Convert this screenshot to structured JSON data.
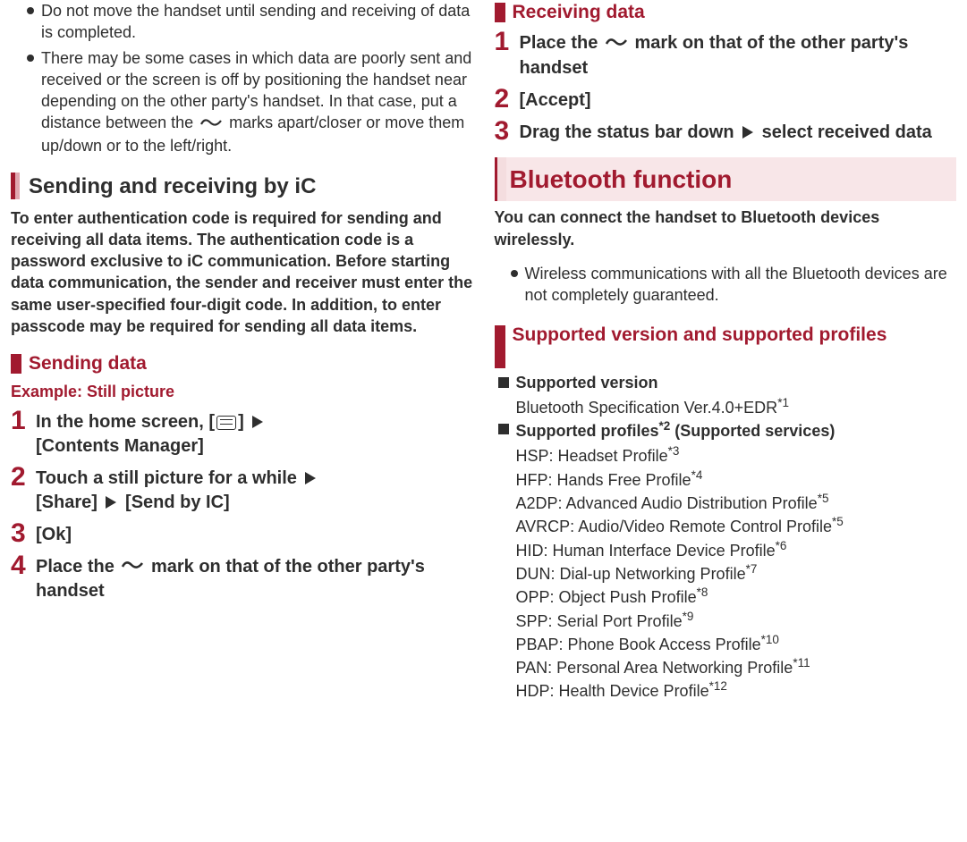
{
  "leftTop": {
    "bullets": [
      "Do not move the handset until sending and receiving of data is completed.",
      {
        "pre": "There may be some cases in which data are poorly sent and received or the screen is off by positioning the handset near depending on the other party's handset. In that case, put a distance between the ",
        "post": " marks apart/closer or move them up/down or to the left/right."
      }
    ]
  },
  "sendRecv": {
    "heading": "Sending and receiving by iC",
    "intro": "To enter authentication code is required for sending and receiving all data items. The authentication code is a password exclusive to iC communication. Before starting data communication, the sender and receiver must enter the same user-specified four-digit code. In addition, to enter passcode may be required for sending all data items."
  },
  "sending": {
    "heading": "Sending data",
    "example": "Example: Still picture",
    "steps": {
      "s1a": "In the home screen, [",
      "s1b": "]",
      "s1c": "[Contents Manager]",
      "s2a": "Touch a still picture for a while",
      "s2b": "[Share]",
      "s2c": "[Send by IC]",
      "s3": "[Ok]",
      "s4a": "Place the ",
      "s4b": " mark on that of the other party's handset"
    }
  },
  "receiving": {
    "heading": "Receiving data",
    "steps": {
      "s1a": "Place the ",
      "s1b": " mark on that of the other party's handset",
      "s2": "[Accept]",
      "s3a": "Drag the status bar down",
      "s3b": "select received data"
    }
  },
  "bluetooth": {
    "heading": "Bluetooth function",
    "intro": "You can connect the handset to Bluetooth devices wirelessly.",
    "bullets": [
      "Wireless communications with all the Bluetooth devices are not completely guaranteed."
    ]
  },
  "profiles": {
    "heading": "Supported version and supported profiles",
    "supportedVersionLabel": "Supported version",
    "supportedVersionBody": "Bluetooth Specification Ver.4.0+EDR",
    "supportedVersionSup": "*1",
    "supportedProfilesLabel": "Supported profiles",
    "supportedProfilesSup": "*2",
    "supportedProfilesSuffix": " (Supported services)",
    "items": [
      {
        "t": "HSP: Headset Profile",
        "s": "*3"
      },
      {
        "t": "HFP: Hands Free Profile",
        "s": "*4"
      },
      {
        "t": "A2DP: Advanced Audio Distribution Profile",
        "s": "*5"
      },
      {
        "t": "AVRCP: Audio/Video Remote Control Profile",
        "s": "*5"
      },
      {
        "t": "HID: Human Interface Device Profile",
        "s": "*6"
      },
      {
        "t": "DUN: Dial-up Networking Profile",
        "s": "*7"
      },
      {
        "t": "OPP: Object Push Profile",
        "s": "*8"
      },
      {
        "t": "SPP: Serial Port Profile",
        "s": "*9"
      },
      {
        "t": "PBAP: Phone Book Access Profile",
        "s": "*10"
      },
      {
        "t": "PAN: Personal Area Networking Profile",
        "s": "*11"
      },
      {
        "t": "HDP: Health Device Profile",
        "s": "*12"
      }
    ]
  }
}
